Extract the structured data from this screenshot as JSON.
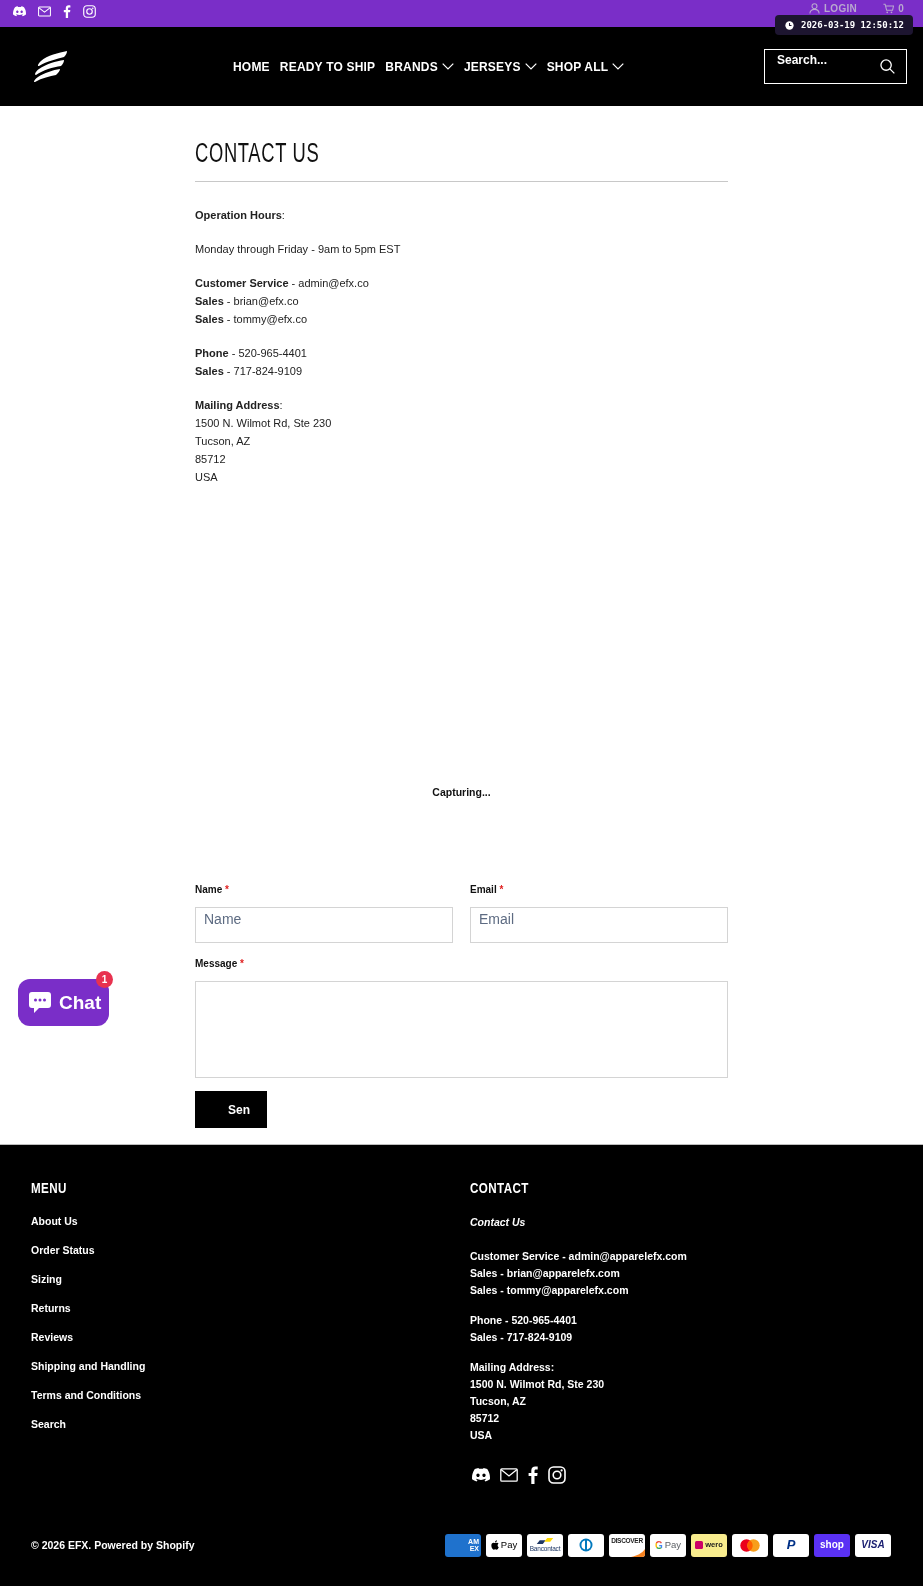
{
  "top_bar": {
    "login": "LOGIN",
    "cart_count": "0"
  },
  "capture_overlay": {
    "timestamp": "2026-03-19 12:50:12"
  },
  "header": {
    "nav": [
      {
        "label": "HOME",
        "dropdown": false
      },
      {
        "label": "READY TO SHIP",
        "dropdown": false
      },
      {
        "label": "BRANDS",
        "dropdown": true
      },
      {
        "label": "JERSEYS",
        "dropdown": true
      },
      {
        "label": "SHOP ALL",
        "dropdown": true
      }
    ],
    "search": {
      "placeholder": "Search..."
    }
  },
  "page": {
    "title": "CONTACT US",
    "paragraphs": [
      [
        "**Operation Hours**:"
      ],
      [
        "Monday through Friday - 9am to 5pm EST"
      ],
      [
        "**Customer Service** - admin@efx.co",
        "**Sales** - brian@efx.co",
        "**Sales** - tommy@efx.co"
      ],
      [
        "**Phone** - 520-965-4401",
        "**Sales** - 717-824-9109"
      ],
      [
        "**Mailing Address**:",
        "1500 N. Wilmot Rd, Ste 230",
        "Tucson, AZ",
        "85712",
        "USA"
      ]
    ]
  },
  "capture_status": {
    "text": "Capturing..."
  },
  "form": {
    "fields": [
      {
        "kind": "input",
        "label": "Name",
        "mark": "*",
        "placeholder": "Name"
      },
      {
        "kind": "input",
        "label": "Email",
        "mark": "*",
        "placeholder": "Email"
      },
      {
        "kind": "textarea",
        "label": "Message",
        "mark": "*"
      }
    ],
    "submit": "Sen"
  },
  "chat_widget": {
    "label": "Chat",
    "badge": "1"
  },
  "footer": {
    "menu": {
      "title": "MENU",
      "links": [
        "About Us",
        "Order Status",
        "Sizing",
        "Returns",
        "Reviews",
        "Shipping and Handling",
        "Terms and Conditions",
        "Search"
      ]
    },
    "contact": {
      "title": "CONTACT",
      "subtitle": "Contact Us",
      "groups": [
        [
          "Customer Service - admin@apparelefx.com",
          "Sales - brian@apparelefx.com",
          "Sales - tommy@apparelefx.com"
        ],
        [
          "Phone - 520-965-4401",
          "Sales - 717-824-9109"
        ],
        [
          "Mailing Address:",
          "1500 N. Wilmot Rd, Ste 230",
          "Tucson, AZ",
          "85712",
          "USA"
        ]
      ]
    },
    "copyright": "© 2026 EFX. Powered by Shopify",
    "payment_methods": [
      {
        "kind": "amex",
        "text": "AM EX"
      },
      {
        "kind": "applepay",
        "text": "Pay"
      },
      {
        "kind": "bancontact",
        "text": "Bancontact"
      },
      {
        "kind": "diners"
      },
      {
        "kind": "discover",
        "text": "DISCOVER"
      },
      {
        "kind": "googlepay",
        "letter": "G",
        "text": "Pay"
      },
      {
        "kind": "ideal_wero",
        "text": "wero"
      },
      {
        "kind": "mastercard"
      },
      {
        "kind": "paypal",
        "text": "P"
      },
      {
        "kind": "shop",
        "text": "shop"
      },
      {
        "kind": "visa",
        "text": "VISA"
      }
    ]
  }
}
